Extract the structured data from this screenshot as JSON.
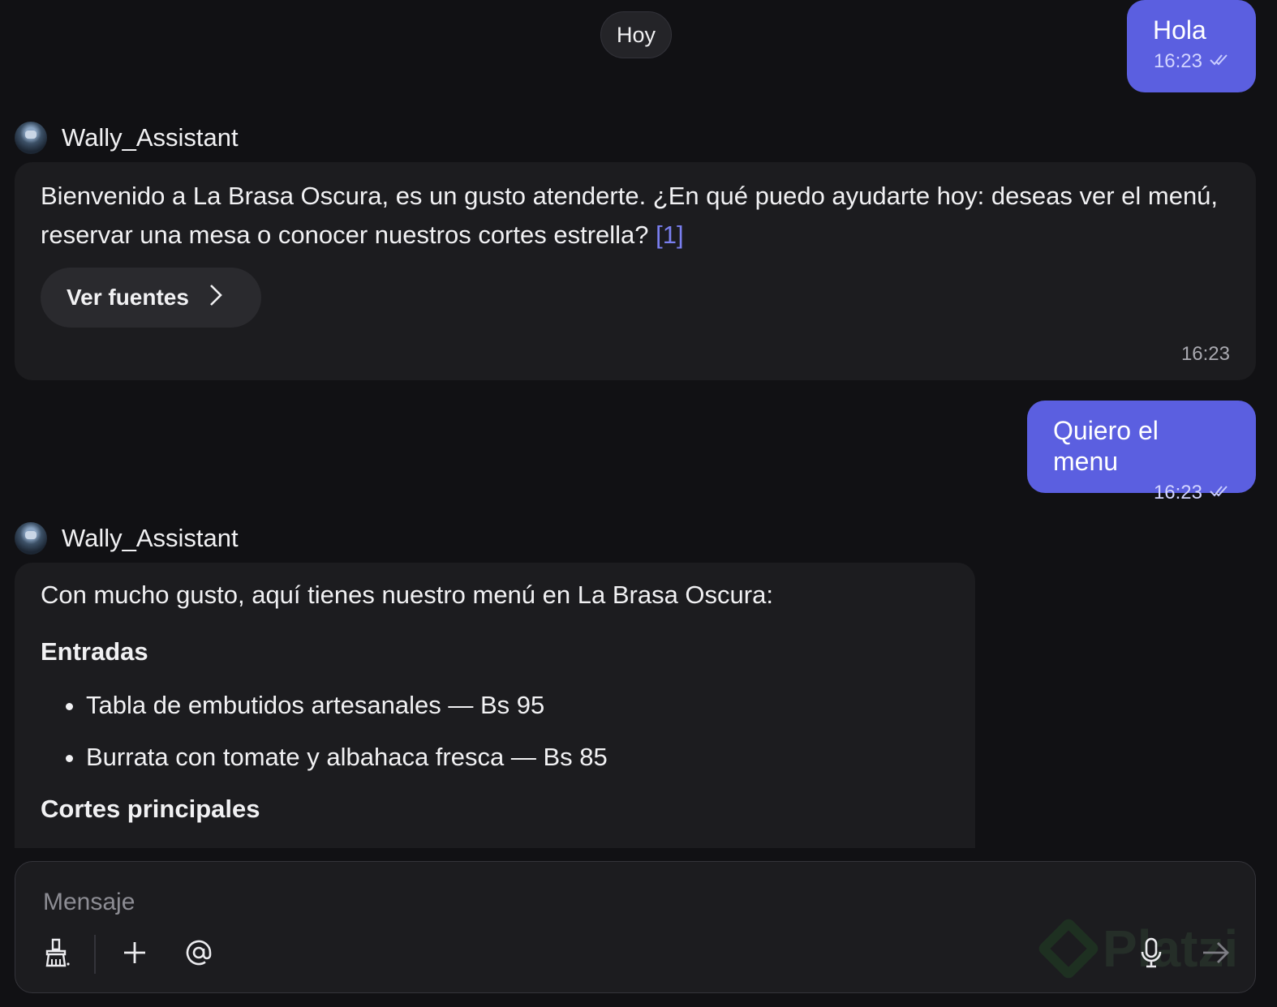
{
  "date_separator": "Hoy",
  "messages": {
    "user1": {
      "text": "Hola",
      "time": "16:23"
    },
    "assistant1": {
      "sender": "Wally_Assistant",
      "text": "Bienvenido a La Brasa Oscura, es un gusto atenderte. ¿En qué puedo ayudarte hoy: deseas ver el menú, reservar una mesa o conocer nuestros cortes estrella?",
      "citation": "[1]",
      "sources_label": "Ver fuentes",
      "time": "16:23"
    },
    "user2": {
      "text": "Quiero el menu",
      "time": "16:23"
    },
    "assistant2": {
      "sender": "Wally_Assistant",
      "intro": "Con mucho gusto, aquí tienes nuestro menú en La Brasa Oscura:",
      "section1_title": "Entradas",
      "section1_items": [
        "Tabla de embutidos artesanales — Bs 95",
        "Burrata con tomate y albahaca fresca — Bs 85"
      ],
      "section2_title": "Cortes principales"
    }
  },
  "composer": {
    "placeholder": "Mensaje",
    "watermark": "Platzi"
  },
  "icons": [
    "double-check-icon",
    "avatar-robot",
    "chevron-right-icon",
    "brush-icon",
    "plus-icon",
    "at-icon",
    "microphone-icon",
    "send-arrow-icon"
  ],
  "colors": {
    "background": "#111114",
    "user_bubble": "#5b5fe0",
    "assistant_bubble": "#1c1c1f",
    "citation": "#7a7ff0"
  }
}
